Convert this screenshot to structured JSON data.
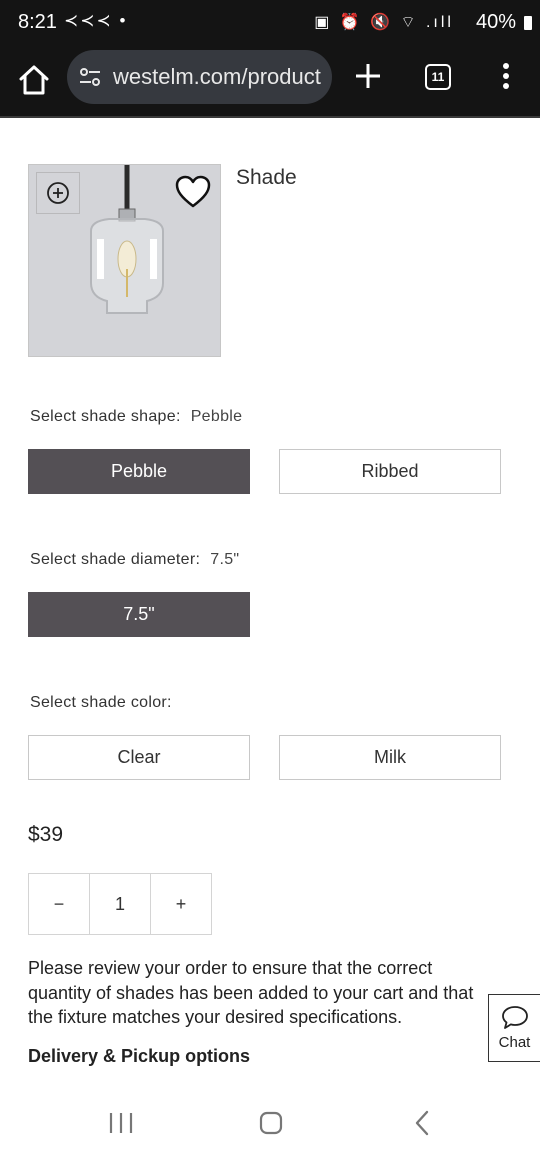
{
  "status_bar": {
    "time": "8:21",
    "left_icons": "≺≺≺ •",
    "right_icons": "▣ ⏰ 🔇 ⌔ .ıll",
    "battery": "40%"
  },
  "browser": {
    "url": "westelm.com/product",
    "tab_count": "11"
  },
  "product": {
    "name": "Shade"
  },
  "options": {
    "shape": {
      "label": "Select shade shape:",
      "selected": "Pebble",
      "choices": [
        "Pebble",
        "Ribbed"
      ]
    },
    "diameter": {
      "label": "Select shade diameter:",
      "selected": "7.5\"",
      "choices": [
        "7.5\""
      ]
    },
    "color": {
      "label": "Select shade color:",
      "choices": [
        "Clear",
        "Milk"
      ]
    }
  },
  "price": "$39",
  "quantity": {
    "minus": "−",
    "value": "1",
    "plus": "+"
  },
  "notice": "Please review your order to ensure that the correct quantity of shades has been added to your cart and that the fixture matches your desired specifications.",
  "delivery_label": "Delivery & Pickup options",
  "chat_label": "Chat",
  "colors": {
    "selected_option": "#545055",
    "browser_bar": "#141414",
    "url_pill": "#36393f"
  }
}
